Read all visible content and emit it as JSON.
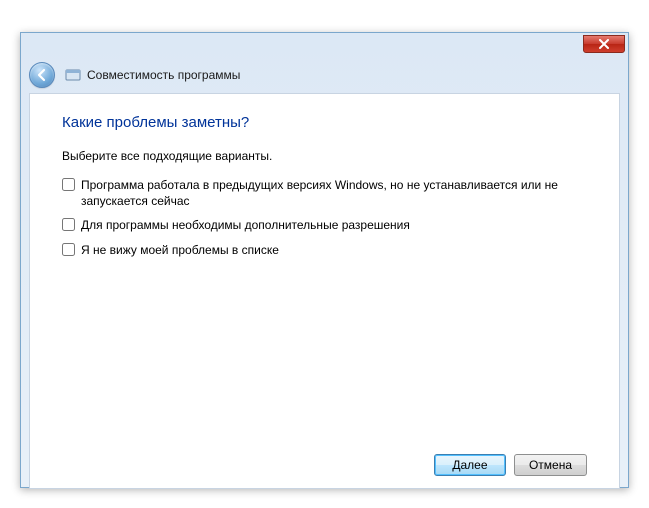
{
  "header": {
    "title": "Совместимость программы"
  },
  "main": {
    "heading": "Какие проблемы заметны?",
    "instruction": "Выберите все подходящие варианты.",
    "options": [
      {
        "label": "Программа работала в предыдущих версиях Windows, но не устанавливается или не запускается сейчас"
      },
      {
        "label": "Для программы необходимы дополнительные разрешения"
      },
      {
        "label": "Я не вижу моей проблемы в списке"
      }
    ]
  },
  "buttons": {
    "next": "Далее",
    "cancel": "Отмена"
  }
}
